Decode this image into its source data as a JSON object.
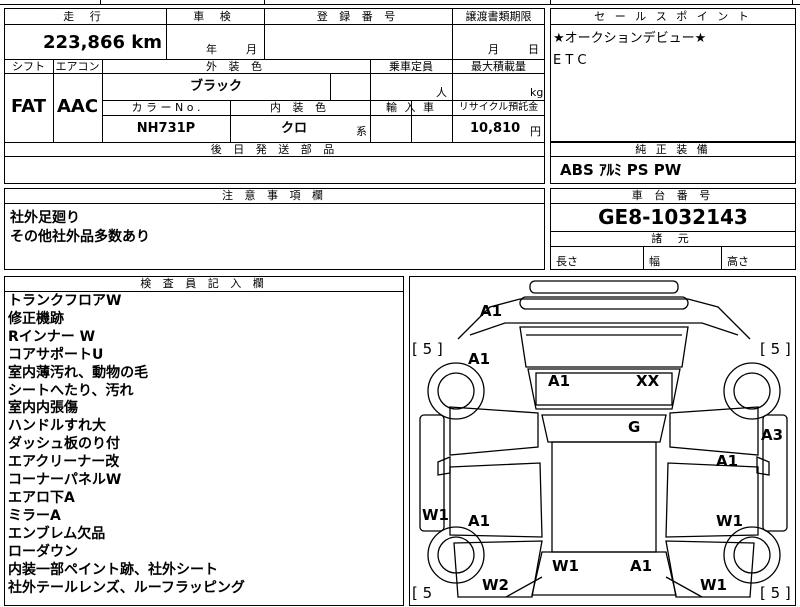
{
  "top_strip": {
    "partial_text": ""
  },
  "spec": {
    "mileage_header": "走 行",
    "mileage_value": "223,866 km",
    "inspection_header": "車 検",
    "inspection_year": "年",
    "inspection_month": "月",
    "registration_header": "登 録 番 号",
    "transfer_header": "譲渡書類期限",
    "transfer_month": "月",
    "transfer_day": "日",
    "shift_header": "シフト",
    "aircon_header": "エアコン",
    "exterior_color_header": "外 装 色",
    "capacity_header": "乗車定員",
    "max_load_header": "最大積載量",
    "shift_value": "FAT",
    "aircon_value": "AAC",
    "exterior_color_value": "ブラック",
    "capacity_unit": "人",
    "load_unit": "kg",
    "color_no_header": "カ ラ ー N o .",
    "interior_color_header": "内 装 色",
    "import_header": "輸 入 車",
    "recycle_header": "リサイクル預託金",
    "color_no_value": "NH731P",
    "interior_color_value": "クロ",
    "interior_color_suffix": "系",
    "recycle_value": "10,810",
    "recycle_unit": "円",
    "shipping_parts_header": "後 日 発 送 部 品"
  },
  "sales_points": {
    "header": "セ ー ル ス ポ イ ン ト",
    "lines": [
      "★オークションデビュー★",
      "E T C"
    ]
  },
  "genuine_equipment": {
    "header": "純 正 装 備",
    "value": "ABS ｱﾙﾐ PS PW"
  },
  "notes": {
    "header": "注 意 事 項 欄",
    "lines": [
      "社外足廻り",
      "その他社外品多数あり"
    ]
  },
  "chassis": {
    "header": "車 台 番 号",
    "value": "GE8-1032143",
    "dims_header": "諸 元",
    "length_label": "長さ",
    "width_label": "幅",
    "height_label": "高さ"
  },
  "inspector": {
    "header": "検 査 員 記 入 欄",
    "remarks": [
      "トランクフロアW",
      "修正機跡",
      "Rインナー W",
      "コアサポートU",
      "室内薄汚れ、動物の毛",
      "シートへたり、汚れ",
      "室内内張傷",
      "ハンドルすれ大",
      "ダッシュ板のり付",
      "エアクリーナー改",
      "コーナーパネルW",
      "エアロ下A",
      "ミラーA",
      "エンブレム欠品",
      "ローダウン",
      "内装一部ペイント跡、社外シート",
      "社外テールレンズ、ルーフラッピング"
    ]
  },
  "diagram": {
    "labels": {
      "rear_bumper": "A1",
      "rear_left_quarter": "A1",
      "trunk": "A1",
      "rear_glass": "XX",
      "roof": "G",
      "right_rear_door": "A1",
      "left_front_door": "A1",
      "right_front_door": "W1",
      "left_sill": "W1",
      "right_sill": "A3",
      "hood_left": "W1",
      "hood_right": "A1",
      "front_left_fender": "W2",
      "front_right_fender": "W1"
    },
    "tire_tl": "[ 5 ]",
    "tire_tr": "[ 5 ]",
    "tire_bl": "[ 5",
    "tire_br": "[ 5 ]"
  }
}
